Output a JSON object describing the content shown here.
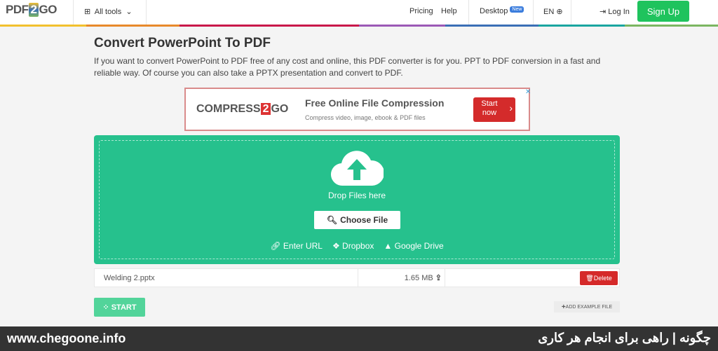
{
  "header": {
    "logo": "PDF2GO",
    "logo_parts": [
      "PDF",
      "2",
      "GO"
    ],
    "all_tools": "All tools",
    "pricing": "Pricing",
    "help": "Help",
    "desktop": "Desktop",
    "new_badge": "New",
    "language": "EN",
    "login": "Log In",
    "signup": "Sign Up"
  },
  "page": {
    "title": "Convert PowerPoint To PDF",
    "description": "If you want to convert PowerPoint to PDF free of any cost and online, this PDF converter is for you. PPT to PDF conversion in a fast and reliable way. Of course you can also take a PPTX presentation and convert to PDF."
  },
  "ad": {
    "logo": "COMPRESS2GO",
    "logo_parts": [
      "COMPRESS",
      "2",
      "GO"
    ],
    "title": "Free Online File Compression",
    "subtitle": "Compress video, image, ebook & PDF files",
    "button": "Start now",
    "close": "✕"
  },
  "upload": {
    "drop_hint": "Drop Files here",
    "choose_file": "Choose File",
    "enter_url": "Enter URL",
    "dropbox": "Dropbox",
    "google_drive": "Google Drive"
  },
  "files": [
    {
      "name": "Welding 2.pptx",
      "size": "1.65 MB",
      "delete": "Delete"
    }
  ],
  "actions": {
    "start": "START",
    "add_example": "ADD EXAMPLE FILE"
  },
  "footer": {
    "site": "www.chegoone.info",
    "tagline": "چگونه | راهی برای انجام هر کاری"
  },
  "colors": {
    "primary_green": "#26c18d",
    "signup_green": "#1fc35d",
    "delete_red": "#d52929",
    "footer_bg": "#333333"
  }
}
